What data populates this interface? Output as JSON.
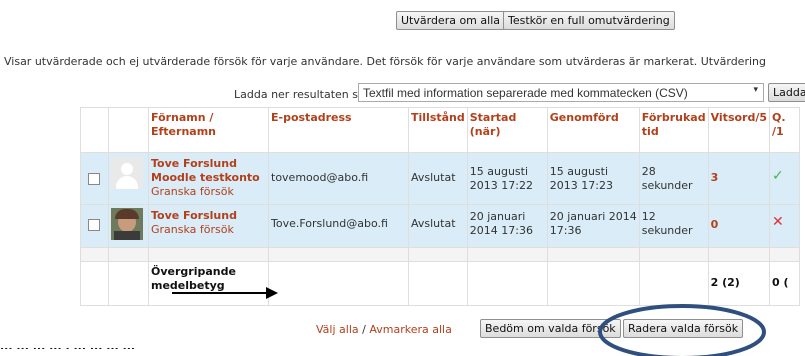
{
  "top_buttons": {
    "regrade_all": "Utvärdera om alla",
    "dryrun": "Testkör en full omutvärdering"
  },
  "info_text": "Visar utvärderade och ej utvärderade försök för varje användare. Det försök för varje användare som utvärderas är markerat. Utvärdering",
  "download": {
    "label": "Ladda ner resultaten som",
    "format": "Textfil med information separerade med kommatecken (CSV)",
    "button": "Ladda"
  },
  "columns": {
    "name": "Förnamn /",
    "name2": "Efternamn",
    "email": "E-postadress",
    "state": "Tillstånd",
    "started": "Startad",
    "started2": "(när)",
    "completed": "Genomförd",
    "timetaken": "Förbrukad",
    "timetaken2": "tid",
    "grade": "Vitsord/5",
    "q1": "Q.",
    "q1b": "/1"
  },
  "rows": [
    {
      "name": "Tove Forslund",
      "name_line2": "Moodle testkonto",
      "review": "Granska försök",
      "email": "tovemood@abo.fi",
      "state": "Avslutat",
      "started": "15 augusti",
      "started2": "2013 17:22",
      "completed": "15 augusti",
      "completed2": "2013 17:23",
      "time": "28",
      "time2": "sekunder",
      "grade": "3",
      "mark": "✓"
    },
    {
      "name": "Tove Forslund",
      "review": "Granska försök",
      "email": "Tove.Forslund@abo.fi",
      "state": "Avslutat",
      "started": "20 januari",
      "started2": "2014 17:36",
      "completed": "20 januari 2014",
      "completed2": "17:36",
      "time": "12",
      "time2": "sekunder",
      "grade": "0",
      "mark": "✕"
    }
  ],
  "summary": {
    "label": "Övergripande",
    "label2": "medelbetyg",
    "grade": "2 (2)",
    "q": "0 ("
  },
  "bottom": {
    "select_all": "Välj alla",
    "sep": "/",
    "deselect_all": "Avmarkera alla",
    "regrade_selected": "Bedöm om valda försök",
    "delete_selected": "Radera valda försök"
  },
  "colors": {
    "link": "#b3401a",
    "row_bg": "#d9ecf7",
    "ellipse": "#2f4f7f",
    "check": "#4caf50",
    "cross": "#e03030"
  },
  "cutoff_text": "...                    ...  ...  ... . ...  ... ... ..."
}
